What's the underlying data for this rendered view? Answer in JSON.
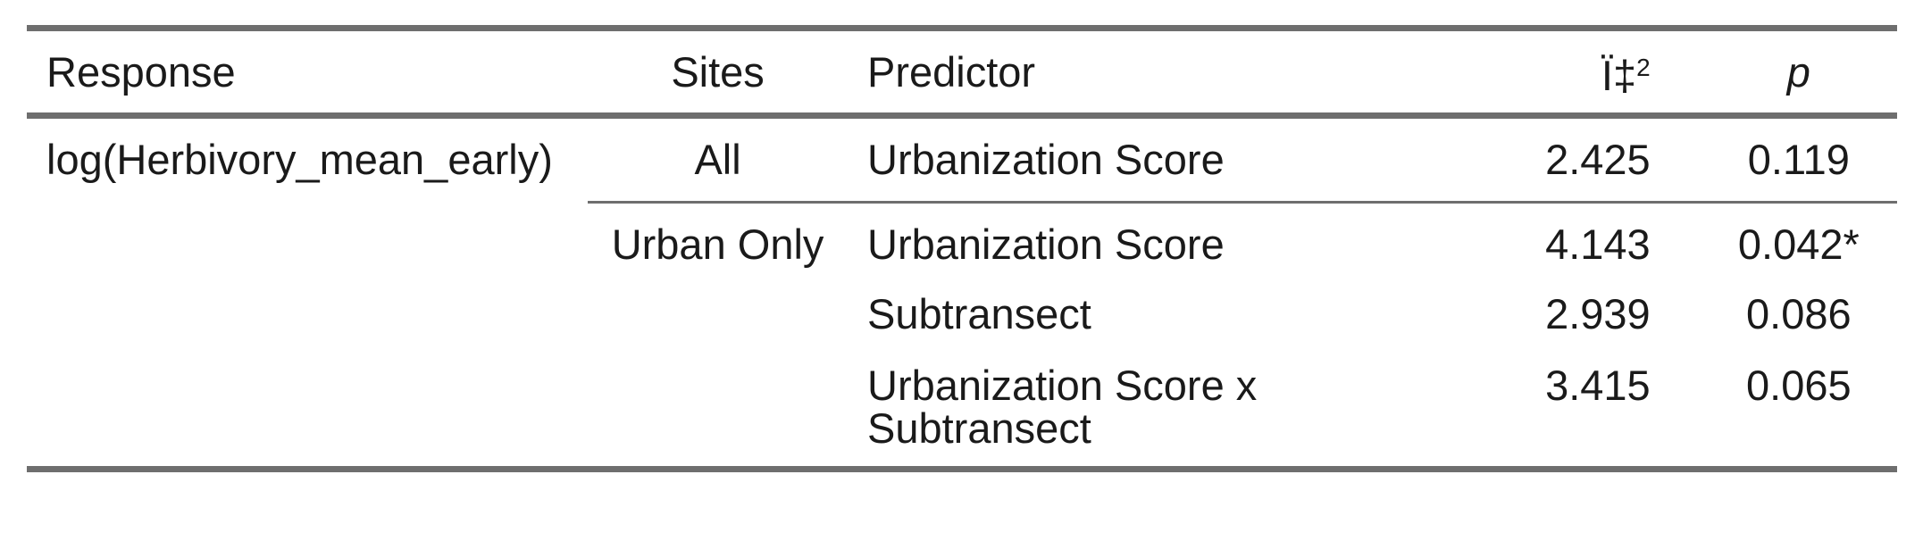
{
  "table": {
    "headers": {
      "response": "Response",
      "sites": "Sites",
      "predictor": "Predictor",
      "chi_base": "Ï‡",
      "chi_sup": "2",
      "p": "p"
    },
    "rows": [
      {
        "response": "log(Herbivory_mean_early)",
        "sites": "All",
        "predictor": "Urbanization Score",
        "chi": "2.425",
        "p": "0.119"
      },
      {
        "response": "",
        "sites": "Urban Only",
        "predictor": "Urbanization Score",
        "chi": "4.143",
        "p": "0.042*"
      },
      {
        "response": "",
        "sites": "",
        "predictor": "Subtransect",
        "chi": "2.939",
        "p": "0.086"
      },
      {
        "response": "",
        "sites": "",
        "predictor_line1": "Urbanization Score x",
        "predictor_line2": "Subtransect",
        "chi": "3.415",
        "p": "0.065"
      }
    ]
  }
}
